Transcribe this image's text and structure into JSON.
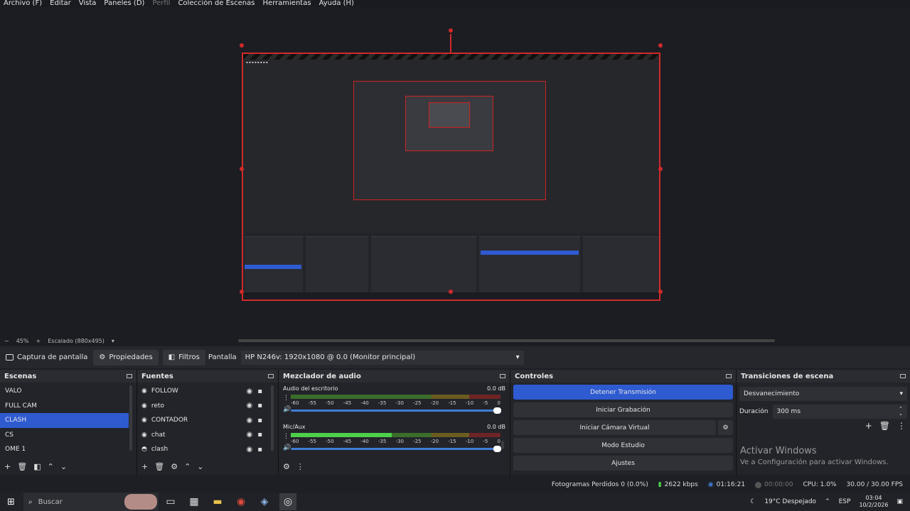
{
  "menu": [
    "Archivo (F)",
    "Editar",
    "Vista",
    "Paneles (D)",
    "Perfil",
    "Colección de Escenas",
    "Herramientas",
    "Ayuda (H)"
  ],
  "zoom": {
    "minus": "−",
    "percent": "45%",
    "plus": "+",
    "scale_label": "Escalado (880x495)",
    "dropdown": "▾"
  },
  "source_toolbar": {
    "source_name": "Captura de pantalla",
    "properties": "Propiedades",
    "filters": "Filtros",
    "screen_label": "Pantalla",
    "monitor_value": "HP N246v: 1920x1080 @ 0.0 (Monitor principal)"
  },
  "scenes": {
    "title": "Escenas",
    "items": [
      "VALO",
      "FULL CAM",
      "CLASH",
      "CS",
      "OME 1"
    ],
    "selected_index": 2
  },
  "sources": {
    "title": "Fuentes",
    "items": [
      "FOLLOW",
      "reto",
      "CONTADOR",
      "chat",
      "clash"
    ]
  },
  "mixer": {
    "title": "Mezclador de audio",
    "tracks": [
      {
        "name": "Audio del escritorio",
        "db": "0.0 dB",
        "level": 0
      },
      {
        "name": "Mic/Aux",
        "db": "0.0 dB",
        "level": 0.48
      }
    ],
    "ticks": [
      "-60",
      "-55",
      "-50",
      "-45",
      "-40",
      "-35",
      "-30",
      "-25",
      "-20",
      "-15",
      "-10",
      "-5",
      "0"
    ]
  },
  "controls": {
    "title": "Controles",
    "stop_stream": "Detener Transmisión",
    "start_recording": "Iniciar Grabación",
    "start_vcam": "Iniciar Cámara Virtual",
    "studio_mode": "Modo Estudio",
    "settings": "Ajustes"
  },
  "transitions": {
    "title": "Transiciones de escena",
    "selected": "Desvanecimiento",
    "duration_label": "Duración",
    "duration_value": "300 ms"
  },
  "watermark": {
    "line1": "Activar Windows",
    "line2": "Ve a Configuración para activar Windows."
  },
  "status": {
    "dropped_frames": "Fotogramas Perdidos 0 (0.0%)",
    "bitrate": "2622 kbps",
    "stream_time": "01:16:21",
    "rec_time": "00:00:00",
    "cpu": "CPU: 1.0%",
    "fps": "30.00 / 30.00 FPS"
  },
  "taskbar": {
    "search_placeholder": "Buscar",
    "weather": "19°C  Despejado",
    "language": "ESP",
    "time": "03:04",
    "date": "10/2/2026"
  },
  "colors": {
    "accent": "#2f5bd1",
    "selection_border": "#d02a2a"
  }
}
